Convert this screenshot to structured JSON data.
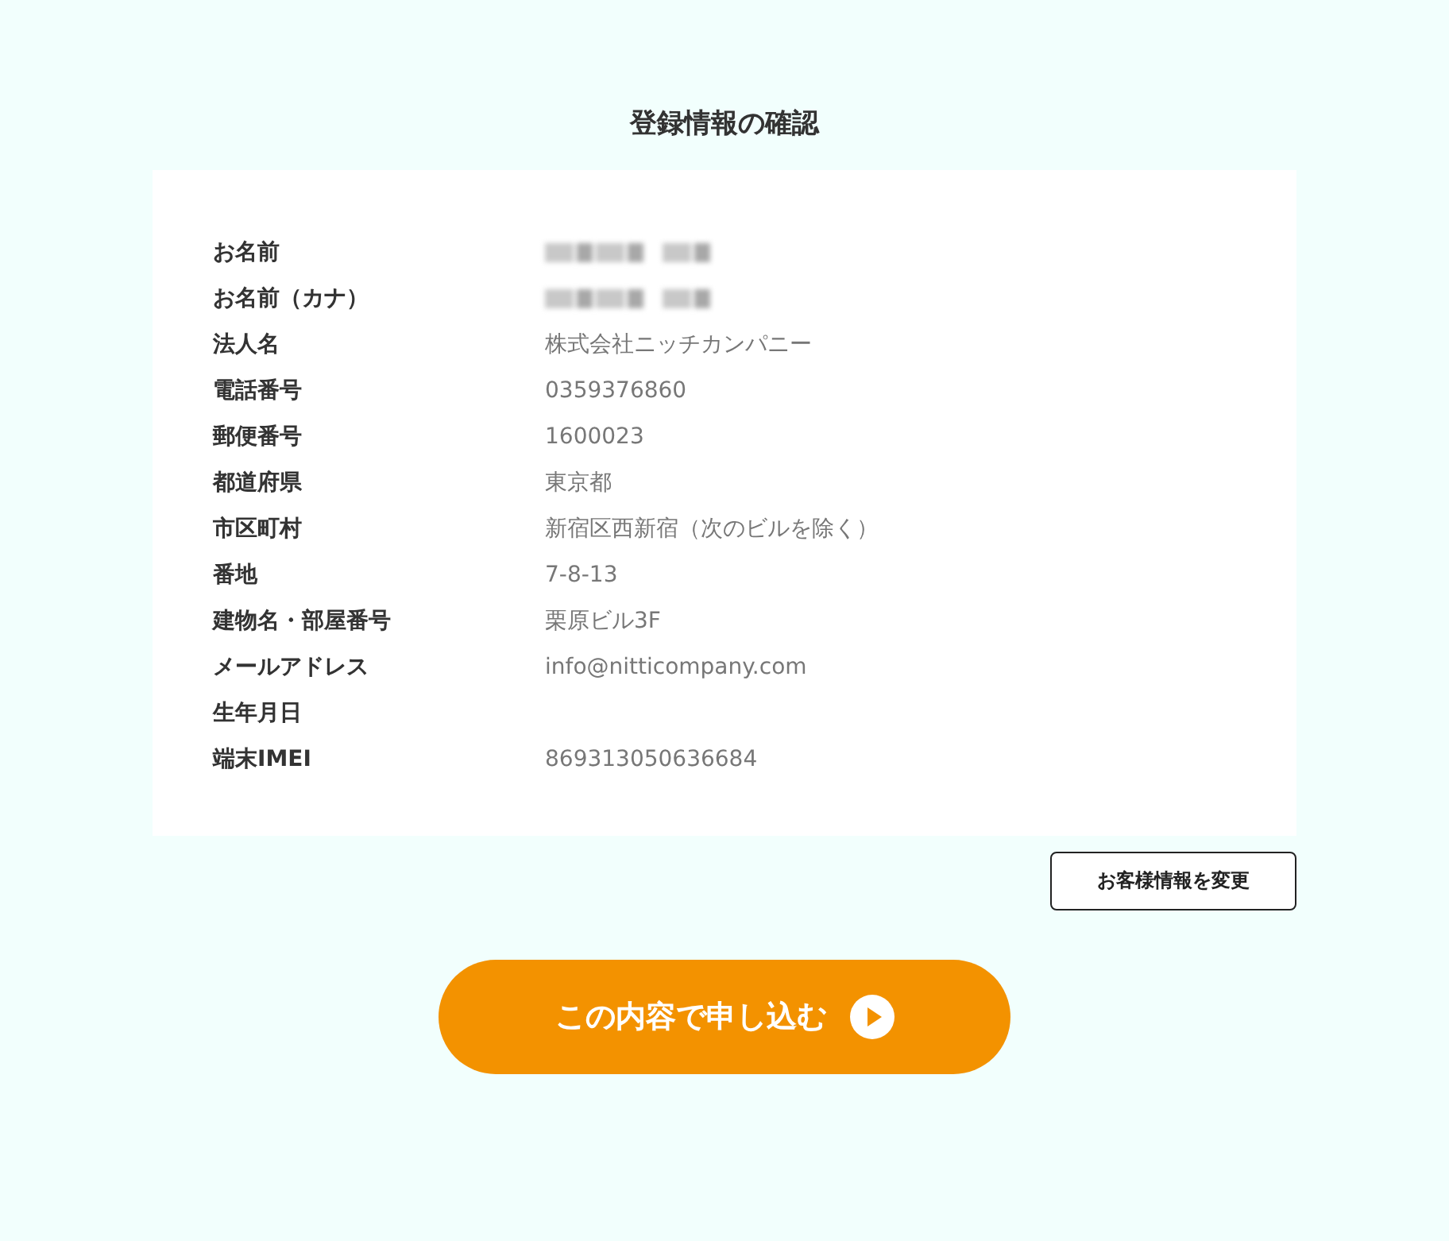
{
  "title": "登録情報の確認",
  "rows": [
    {
      "label": "お名前",
      "redacted": true
    },
    {
      "label": "お名前（カナ）",
      "redacted": true
    },
    {
      "label": "法人名",
      "value": "株式会社ニッチカンパニー"
    },
    {
      "label": "電話番号",
      "value": "0359376860"
    },
    {
      "label": "郵便番号",
      "value": "1600023"
    },
    {
      "label": "都道府県",
      "value": "東京都"
    },
    {
      "label": "市区町村",
      "value": "新宿区西新宿（次のビルを除く）"
    },
    {
      "label": "番地",
      "value": "7-8-13"
    },
    {
      "label": "建物名・部屋番号",
      "value": "栗原ビル3F"
    },
    {
      "label": "メールアドレス",
      "value": "info@nitticompany.com"
    },
    {
      "label": "生年月日"
    },
    {
      "label": "端末IMEI",
      "value": "869313050636684"
    }
  ],
  "edit_button": "お客様情報を変更",
  "submit_button": "この内容で申し込む"
}
